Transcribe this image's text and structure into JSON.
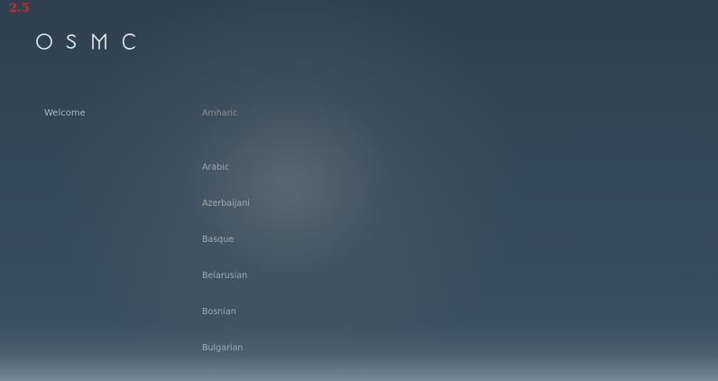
{
  "version_label": "2.5",
  "logo": {
    "text": "OSMC",
    "icon": "osmc-logo"
  },
  "sidebar": {
    "items": [
      {
        "label": "Welcome"
      }
    ]
  },
  "languages": {
    "selected": "Amharic",
    "items": [
      {
        "label": "Amharic"
      },
      {
        "label": "Arabic"
      },
      {
        "label": "Azerbaijani"
      },
      {
        "label": "Basque"
      },
      {
        "label": "Belarusian"
      },
      {
        "label": "Bosnian"
      },
      {
        "label": "Bulgarian"
      }
    ]
  },
  "colors": {
    "accent_red": "#e0202a",
    "text": "#9fabb4"
  }
}
